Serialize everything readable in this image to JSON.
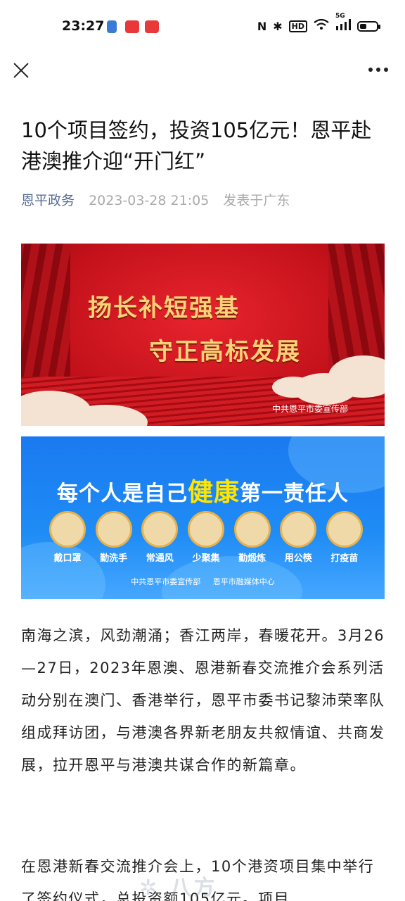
{
  "status_bar": {
    "time": "23:27",
    "network_label": "5G",
    "icons": [
      "nfc-icon",
      "bluetooth-icon",
      "hd-icon",
      "wifi-icon",
      "signal-icon",
      "battery-icon"
    ]
  },
  "nav": {
    "close_icon": "close-icon",
    "more_icon": "more-icon"
  },
  "article": {
    "title": "10个项目签约，投资105亿元！恩平赴港澳推介迎“开门红”",
    "author": "恩平政务",
    "date": "2023-03-28 21:05",
    "location": "发表于广东",
    "banner1": {
      "line1": "扬长补短强基",
      "line2": "守正高标发展",
      "credit": "中共恩平市委宣传部"
    },
    "banner2": {
      "slogan_pre": "每个人是自己",
      "slogan_highlight": "健康",
      "slogan_post": "第一责任人",
      "icons": [
        "戴口罩",
        "勤洗手",
        "常通风",
        "少聚集",
        "勤煅炼",
        "用公筷",
        "打疫苗"
      ],
      "credit": "中共恩平市委宣传部   恩平市融媒体中心"
    },
    "paragraph1": "南海之滨，风劲潮涌；香江两岸，春暖花开。3月26—27日，2023年恩澳、恩港新春交流推介会系列活动分别在澳门、香港举行，恩平市委书记黎沛荣率队组成拜访团，与港澳各界新老朋友共叙情谊、共商发展，拉开恩平与港澳共谋合作的新篇章。",
    "paragraph2": "在恩港新春交流推介会上，10个港资项目集中举行了签约仪式，总投资额105亿元。项目"
  },
  "colors": {
    "author_link": "#576b95",
    "meta_gray": "#aaaaaa"
  }
}
